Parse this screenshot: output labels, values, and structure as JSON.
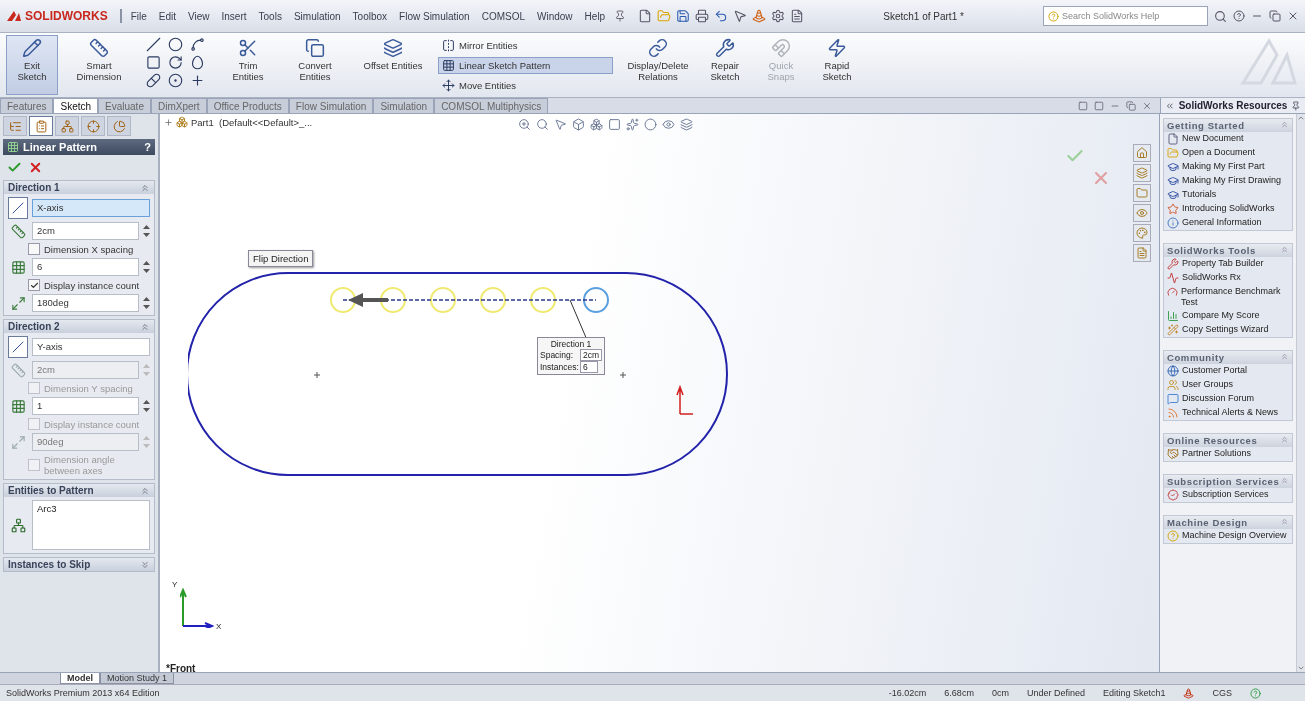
{
  "title_bar": {
    "logo": "SOLIDWORKS",
    "menus": [
      "File",
      "Edit",
      "View",
      "Insert",
      "Tools",
      "Simulation",
      "Toolbox",
      "Flow Simulation",
      "COMSOL",
      "Window",
      "Help"
    ],
    "document_title": "Sketch1 of Part1 *",
    "search": {
      "placeholder": "Search SolidWorks Help"
    }
  },
  "ribbon": [
    {
      "kind": "button",
      "label": "Exit Sketch",
      "selected": true,
      "disabled": false
    },
    {
      "kind": "button",
      "label": "Smart Dimension",
      "selected": false,
      "disabled": false
    },
    {
      "kind": "entity_grid"
    },
    {
      "kind": "button",
      "label": "Trim Entities",
      "selected": false,
      "disabled": false
    },
    {
      "kind": "button",
      "label": "Convert Entities",
      "selected": false,
      "disabled": false
    },
    {
      "kind": "button",
      "label": "Offset Entities",
      "selected": false,
      "disabled": false
    },
    {
      "kind": "stack",
      "items": [
        {
          "label": "Mirror Entities",
          "selected": false
        },
        {
          "label": "Linear Sketch Pattern",
          "selected": true
        },
        {
          "label": "Move Entities",
          "selected": false
        }
      ]
    },
    {
      "kind": "button",
      "label": "Display/Delete Relations",
      "selected": false,
      "disabled": false
    },
    {
      "kind": "button",
      "label": "Repair Sketch",
      "selected": false,
      "disabled": false
    },
    {
      "kind": "button",
      "label": "Quick Snaps",
      "selected": false,
      "disabled": true
    },
    {
      "kind": "button",
      "label": "Rapid Sketch",
      "selected": false,
      "disabled": false
    }
  ],
  "command_tabs": [
    {
      "label": "Features",
      "selected": false
    },
    {
      "label": "Sketch",
      "selected": true
    },
    {
      "label": "Evaluate",
      "selected": false
    },
    {
      "label": "DimXpert",
      "selected": false
    },
    {
      "label": "Office Products",
      "selected": false
    },
    {
      "label": "Flow Simulation",
      "selected": false
    },
    {
      "label": "Simulation",
      "selected": false
    },
    {
      "label": "COMSOL Multiphysics",
      "selected": false
    }
  ],
  "property_manager": {
    "tabs": [
      {
        "selected": false
      },
      {
        "selected": true
      },
      {
        "selected": false
      },
      {
        "selected": false
      },
      {
        "selected": false
      }
    ],
    "title": "Linear Pattern",
    "help": "?",
    "sections": [
      {
        "title": "Direction 1",
        "expanded": true,
        "rows": [
          {
            "kind": "axis",
            "value": "X-axis",
            "selected": true,
            "disabled": false
          },
          {
            "kind": "spin",
            "value": "2cm",
            "disabled": false
          },
          {
            "kind": "check",
            "label": "Dimension X spacing",
            "checked": false,
            "disabled": false
          },
          {
            "kind": "spin",
            "value": "6",
            "disabled": false
          },
          {
            "kind": "check",
            "label": "Display instance count",
            "checked": true,
            "disabled": false
          },
          {
            "kind": "spin",
            "value": "180deg",
            "disabled": false
          }
        ]
      },
      {
        "title": "Direction 2",
        "expanded": true,
        "rows": [
          {
            "kind": "axis",
            "value": "Y-axis",
            "selected": false,
            "disabled": false
          },
          {
            "kind": "spin",
            "value": "2cm",
            "disabled": true
          },
          {
            "kind": "check",
            "label": "Dimension Y spacing",
            "checked": false,
            "disabled": true
          },
          {
            "kind": "spin",
            "value": "1",
            "disabled": false
          },
          {
            "kind": "check",
            "label": "Display instance count",
            "checked": false,
            "disabled": true
          },
          {
            "kind": "spin",
            "value": "90deg",
            "disabled": true
          },
          {
            "kind": "check",
            "label": "Dimension angle between axes",
            "checked": false,
            "disabled": true
          }
        ]
      },
      {
        "title": "Entities to Pattern",
        "expanded": true,
        "rows": [
          {
            "kind": "list",
            "items": [
              "Arc3"
            ]
          }
        ]
      },
      {
        "title": "Instances to Skip",
        "expanded": false
      }
    ]
  },
  "canvas": {
    "tree_item": "Part1  (Default<<Default>_...",
    "tooltip": "Flip Direction",
    "callout": {
      "title": "Direction 1",
      "rows": [
        {
          "label": "Spacing:",
          "value": "2cm"
        },
        {
          "label": "Instances:",
          "value": "6"
        }
      ]
    },
    "view_label": "*Front",
    "triad": {
      "x": "X",
      "y": "Y"
    }
  },
  "task_pane": {
    "title": "SolidWorks Resources",
    "groups": [
      {
        "title": "Getting Started",
        "items": [
          "New Document",
          "Open a Document",
          "Making My First Part",
          "Making My First Drawing",
          "Tutorials",
          "Introducing SolidWorks",
          "General Information"
        ]
      },
      {
        "title": "SolidWorks Tools",
        "items": [
          "Property Tab Builder",
          "SolidWorks Rx",
          "Performance Benchmark Test",
          "Compare My Score",
          "Copy Settings Wizard"
        ]
      },
      {
        "title": "Community",
        "items": [
          "Customer Portal",
          "User Groups",
          "Discussion Forum",
          "Technical Alerts & News"
        ]
      },
      {
        "title": "Online Resources",
        "items": [
          "Partner Solutions"
        ]
      },
      {
        "title": "Subscription Services",
        "items": [
          "Subscription Services"
        ]
      },
      {
        "title": "Machine Design",
        "items": [
          "Machine Design Overview"
        ]
      }
    ]
  },
  "bottom_tabs": [
    {
      "label": "Model",
      "selected": true
    },
    {
      "label": "Motion Study 1",
      "selected": false
    }
  ],
  "status_bar": {
    "edition": "SolidWorks Premium 2013 x64 Edition",
    "fields": [
      "-16.02cm",
      "6.68cm",
      "0cm",
      "Under Defined",
      "Editing Sketch1"
    ],
    "units": "CGS"
  }
}
